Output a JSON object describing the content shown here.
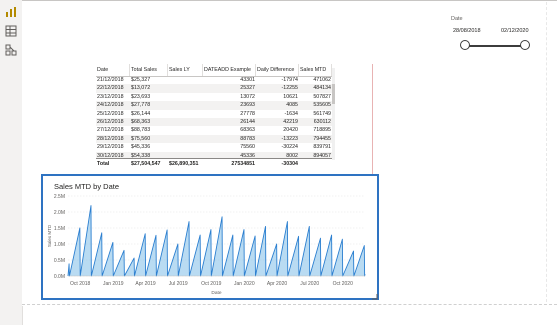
{
  "rail": {
    "icons": [
      "bar-chart-icon",
      "table-icon",
      "model-icon"
    ]
  },
  "slicer": {
    "title": "Date",
    "start_date": "28/08/2018",
    "end_date": "02/12/2020",
    "range_start_fraction": 0.0,
    "range_end_fraction": 1.0
  },
  "table": {
    "columns": [
      "Date",
      "Total Sales",
      "Sales LY",
      "DATEADD Example",
      "Daily Difference",
      "Sales MTD"
    ],
    "rows": [
      [
        "21/12/2018",
        "$25,327",
        "",
        "43301",
        "-17974",
        "471062"
      ],
      [
        "22/12/2018",
        "$13,072",
        "",
        "25327",
        "-12255",
        "484134"
      ],
      [
        "23/12/2018",
        "$23,693",
        "",
        "13072",
        "10621",
        "507827"
      ],
      [
        "24/12/2018",
        "$27,778",
        "",
        "23693",
        "4085",
        "535605"
      ],
      [
        "25/12/2018",
        "$26,144",
        "",
        "27778",
        "-1634",
        "561749"
      ],
      [
        "26/12/2018",
        "$68,363",
        "",
        "26144",
        "42219",
        "630112"
      ],
      [
        "27/12/2018",
        "$88,783",
        "",
        "68363",
        "20420",
        "718895"
      ],
      [
        "28/12/2018",
        "$75,560",
        "",
        "88783",
        "-13223",
        "794455"
      ],
      [
        "29/12/2018",
        "$45,336",
        "",
        "75560",
        "-30224",
        "839791"
      ],
      [
        "30/12/2018",
        "$54,338",
        "",
        "45336",
        "8002",
        "894057"
      ]
    ],
    "total": [
      "Total",
      "$27,504,547",
      "$26,890,351",
      "27534851",
      "-30304",
      ""
    ]
  },
  "chart": {
    "title": "Sales MTD by Date",
    "colors": {
      "line": "#2b7fd0",
      "fill": "#7fbde8",
      "border": "#2e73c2"
    },
    "tool_icons": [
      "filter-icon",
      "focus-mode-icon",
      "more-options-icon"
    ]
  },
  "chart_data": {
    "type": "area",
    "title": "Sales MTD by Date",
    "xlabel": "Date",
    "ylabel": "Sales MTD",
    "y_ticks": [
      "0.0M",
      "0.5M",
      "1.0M",
      "1.5M",
      "2.0M",
      "2.5M"
    ],
    "x_ticks": [
      "Oct 2018",
      "Jan 2019",
      "Apr 2019",
      "Jul 2019",
      "Oct 2019",
      "Jan 2020",
      "Apr 2020",
      "Jul 2020",
      "Oct 2020"
    ],
    "ylim": [
      0,
      2500000
    ],
    "xlim": [
      "2018-08-28",
      "2020-12-02"
    ],
    "x_tick_dates": [
      "2018-10-01",
      "2019-01-01",
      "2019-04-01",
      "2019-07-01",
      "2019-10-01",
      "2020-01-01",
      "2020-04-01",
      "2020-07-01",
      "2020-10-01"
    ],
    "series": [
      {
        "values": [
          [
            "2018-08-28",
            0
          ],
          [
            "2018-08-31",
            380000
          ],
          [
            "2018-09-01",
            0
          ],
          [
            "2018-09-30",
            1500000
          ],
          [
            "2018-10-01",
            0
          ],
          [
            "2018-10-31",
            2200000
          ],
          [
            "2018-11-01",
            0
          ],
          [
            "2018-11-30",
            1350000
          ],
          [
            "2018-12-01",
            0
          ],
          [
            "2018-12-31",
            1050000
          ],
          [
            "2019-01-01",
            0
          ],
          [
            "2019-01-31",
            800000
          ],
          [
            "2019-02-01",
            0
          ],
          [
            "2019-02-28",
            560000
          ],
          [
            "2019-03-01",
            0
          ],
          [
            "2019-03-31",
            1320000
          ],
          [
            "2019-04-01",
            0
          ],
          [
            "2019-04-30",
            1270000
          ],
          [
            "2019-05-01",
            0
          ],
          [
            "2019-05-31",
            1440000
          ],
          [
            "2019-06-01",
            0
          ],
          [
            "2019-06-30",
            1000000
          ],
          [
            "2019-07-01",
            0
          ],
          [
            "2019-07-31",
            1700000
          ],
          [
            "2019-08-01",
            0
          ],
          [
            "2019-08-31",
            1280000
          ],
          [
            "2019-09-01",
            0
          ],
          [
            "2019-09-30",
            1450000
          ],
          [
            "2019-10-01",
            0
          ],
          [
            "2019-10-31",
            1850000
          ],
          [
            "2019-11-01",
            0
          ],
          [
            "2019-11-30",
            1280000
          ],
          [
            "2019-12-01",
            0
          ],
          [
            "2019-12-31",
            1450000
          ],
          [
            "2020-01-01",
            0
          ],
          [
            "2020-01-31",
            1250000
          ],
          [
            "2020-02-01",
            0
          ],
          [
            "2020-02-29",
            1550000
          ],
          [
            "2020-03-01",
            0
          ],
          [
            "2020-03-31",
            1000000
          ],
          [
            "2020-04-01",
            0
          ],
          [
            "2020-04-30",
            1700000
          ],
          [
            "2020-05-01",
            0
          ],
          [
            "2020-05-31",
            1240000
          ],
          [
            "2020-06-01",
            0
          ],
          [
            "2020-06-30",
            1550000
          ],
          [
            "2020-07-01",
            0
          ],
          [
            "2020-07-31",
            1180000
          ],
          [
            "2020-08-01",
            0
          ],
          [
            "2020-08-31",
            1280000
          ],
          [
            "2020-09-01",
            0
          ],
          [
            "2020-09-30",
            1150000
          ],
          [
            "2020-10-01",
            0
          ],
          [
            "2020-10-31",
            780000
          ],
          [
            "2020-11-01",
            0
          ],
          [
            "2020-11-30",
            950000
          ],
          [
            "2020-12-01",
            0
          ],
          [
            "2020-12-02",
            60000
          ]
        ]
      }
    ],
    "grid": true,
    "legend": "none"
  }
}
